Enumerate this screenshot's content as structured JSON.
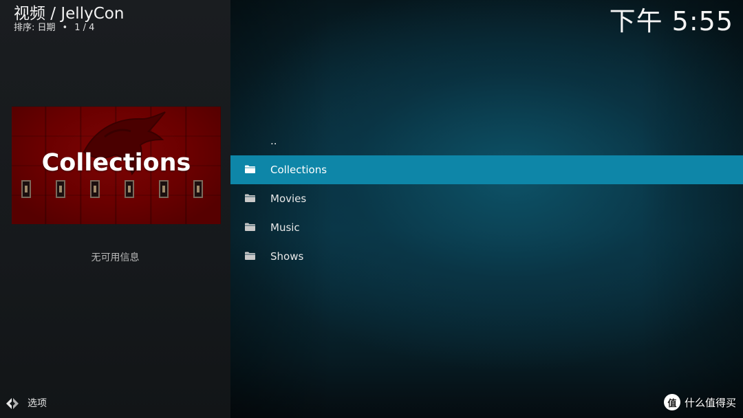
{
  "header": {
    "title": "视频 / JellyCon",
    "sort_label": "排序: 日期",
    "separator": "•",
    "page_count": "1 / 4"
  },
  "clock": "下午 5:55",
  "poster": {
    "title": "Collections"
  },
  "info": {
    "no_info_text": "无可用信息"
  },
  "list": {
    "items": [
      {
        "label": "..",
        "icon": "none",
        "selected": false
      },
      {
        "label": "Collections",
        "icon": "folder-icon",
        "selected": true
      },
      {
        "label": "Movies",
        "icon": "folder-icon",
        "selected": false
      },
      {
        "label": "Music",
        "icon": "folder-icon",
        "selected": false
      },
      {
        "label": "Shows",
        "icon": "folder-icon",
        "selected": false
      }
    ]
  },
  "footer": {
    "options_label": "选项",
    "options_icon": "options-arrows-icon",
    "watermark_logo": "值",
    "watermark_text": "什么值得买"
  },
  "colors": {
    "selection": "#0e86a8",
    "left_panel": "#16191c",
    "poster_red": "#6a0000"
  }
}
